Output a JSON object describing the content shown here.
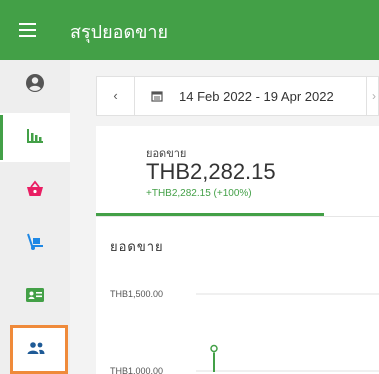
{
  "app": {
    "title": "สรุปยอดขาย"
  },
  "sidebar": {
    "items": [
      {
        "name": "account",
        "icon": "account-circle-icon"
      },
      {
        "name": "reports",
        "icon": "bar-chart-icon",
        "active": true
      },
      {
        "name": "orders",
        "icon": "basket-icon"
      },
      {
        "name": "inventory",
        "icon": "hand-truck-icon"
      },
      {
        "name": "customers",
        "icon": "id-card-icon"
      },
      {
        "name": "employees",
        "icon": "people-icon",
        "highlighted": true
      }
    ]
  },
  "date_range": {
    "text": "14 Feb 2022 - 19 Apr 2022"
  },
  "stat": {
    "label": "ยอดขาย",
    "value": "THB2,282.15",
    "change": "+THB2,282.15 (+100%)"
  },
  "colors": {
    "primary": "#43a047",
    "highlight": "#ef8a3a"
  },
  "chart_data": {
    "type": "line",
    "title": "ยอดขาย",
    "y_tick_labels": [
      "THB1,500.00",
      "THB1,000.00"
    ],
    "series": [
      {
        "color": "#43a047",
        "visible_values": [
          1000,
          1000,
          1000,
          1120
        ]
      }
    ]
  }
}
